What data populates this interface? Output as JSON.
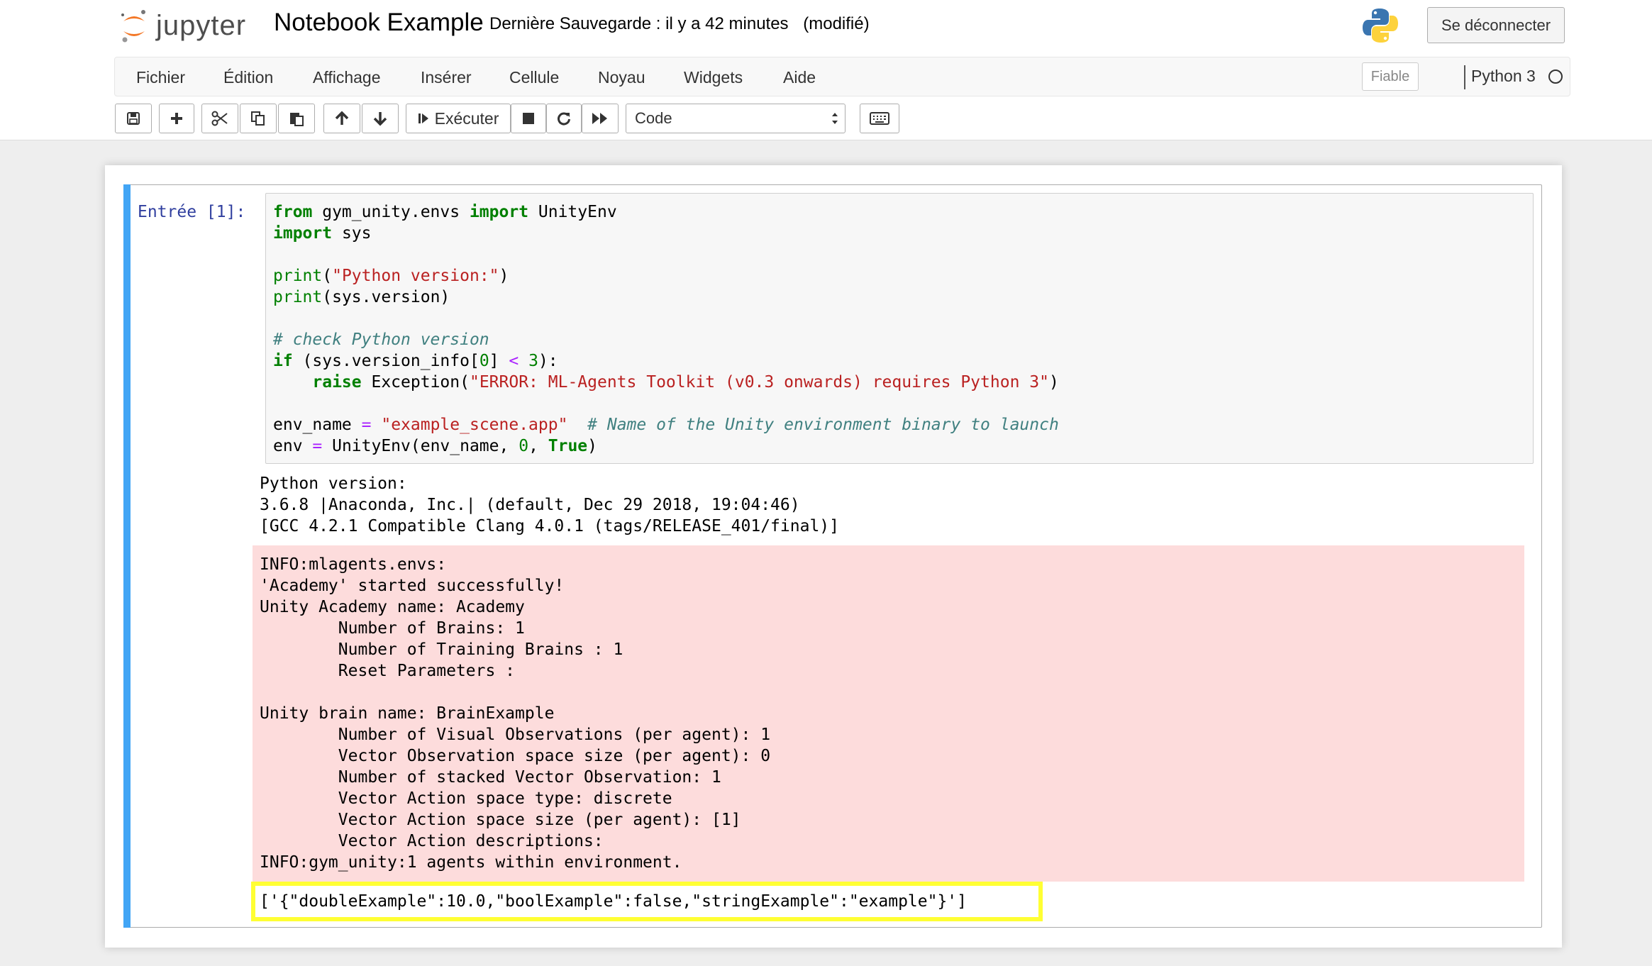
{
  "header": {
    "logo_text": "jupyter",
    "notebook_title": "Notebook Example",
    "save_status": "Dernière Sauvegarde : il y a 42 minutes",
    "modified": "(modifié)",
    "logout_label": "Se déconnecter"
  },
  "menubar": {
    "items": [
      {
        "label": "Fichier"
      },
      {
        "label": "Édition"
      },
      {
        "label": "Affichage"
      },
      {
        "label": "Insérer"
      },
      {
        "label": "Cellule"
      },
      {
        "label": "Noyau"
      },
      {
        "label": "Widgets"
      },
      {
        "label": "Aide"
      }
    ],
    "trusted_label": "Fiable",
    "kernel_name": "Python 3"
  },
  "toolbar": {
    "run_label": "Exécuter",
    "cell_type": "Code",
    "icons": [
      "save-icon",
      "plus-icon",
      "cut-icon",
      "copy-icon",
      "paste-icon",
      "arrow-up-icon",
      "arrow-down-icon",
      "step-forward-icon",
      "stop-icon",
      "restart-icon",
      "fast-forward-icon",
      "keyboard-icon"
    ]
  },
  "cell": {
    "prompt": "Entrée [1]:",
    "code_lines": [
      "from gym_unity.envs import UnityEnv",
      "import sys",
      "",
      "print(\"Python version:\")",
      "print(sys.version)",
      "",
      "# check Python version",
      "if (sys.version_info[0] < 3):",
      "    raise Exception(\"ERROR: ML-Agents Toolkit (v0.3 onwards) requires Python 3\")",
      "",
      "env_name = \"example_scene.app\"  # Name of the Unity environment binary to launch",
      "env = UnityEnv(env_name, 0, True)"
    ],
    "stdout_lines": [
      "Python version:",
      "3.6.8 |Anaconda, Inc.| (default, Dec 29 2018, 19:04:46)",
      "[GCC 4.2.1 Compatible Clang 4.0.1 (tags/RELEASE_401/final)]"
    ],
    "stderr_lines": [
      "INFO:mlagents.envs:",
      "'Academy' started successfully!",
      "Unity Academy name: Academy",
      "        Number of Brains: 1",
      "        Number of Training Brains : 1",
      "        Reset Parameters :",
      "",
      "Unity brain name: BrainExample",
      "        Number of Visual Observations (per agent): 1",
      "        Vector Observation space size (per agent): 0",
      "        Number of stacked Vector Observation: 1",
      "        Vector Action space type: discrete",
      "        Vector Action space size (per agent): [1]",
      "        Vector Action descriptions: ",
      "INFO:gym_unity:1 agents within environment."
    ],
    "result_line": "['{\"doubleExample\":10.0,\"boolExample\":false,\"stringExample\":\"example\"}']"
  },
  "colors": {
    "cell_bar": "#42a5f5",
    "stderr_bg": "#fddcdc",
    "highlight": "#ffff33",
    "prompt": "#303f9f"
  }
}
